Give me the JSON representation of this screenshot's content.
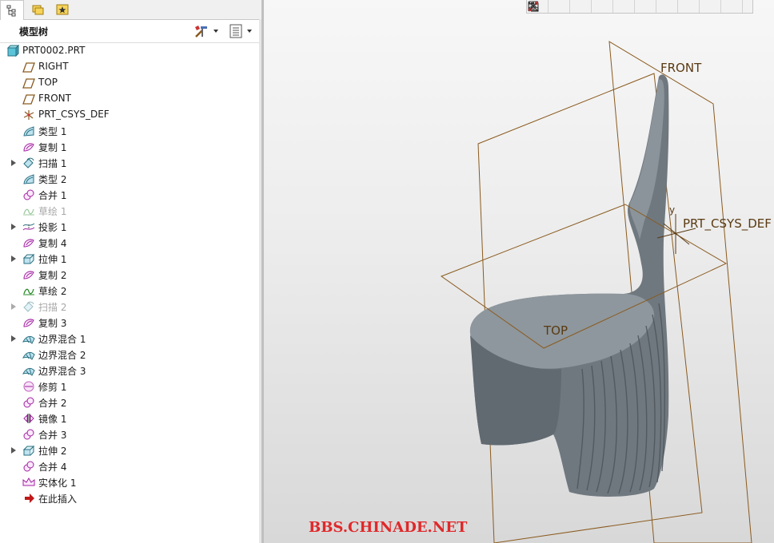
{
  "panel": {
    "tabs": [
      {
        "name": "model-tree-tab-icon",
        "active": true
      },
      {
        "name": "folder-browser-tab-icon",
        "active": false
      },
      {
        "name": "favorites-tab-icon",
        "active": false
      }
    ],
    "title": "模型树",
    "settings_icon": "tree-settings-icon",
    "columns_icon": "tree-columns-icon"
  },
  "tree": {
    "items": [
      {
        "label": "PRT0002.PRT",
        "icon": "part-icon",
        "expandable": false,
        "disabled": false,
        "root": true
      },
      {
        "label": "RIGHT",
        "icon": "datum-plane-icon",
        "expandable": false,
        "disabled": false
      },
      {
        "label": "TOP",
        "icon": "datum-plane-icon",
        "expandable": false,
        "disabled": false
      },
      {
        "label": "FRONT",
        "icon": "datum-plane-icon",
        "expandable": false,
        "disabled": false
      },
      {
        "label": "PRT_CSYS_DEF",
        "icon": "csys-icon",
        "expandable": false,
        "disabled": false
      },
      {
        "label": "类型 1",
        "icon": "style-icon",
        "expandable": false,
        "disabled": false
      },
      {
        "label": "复制 1",
        "icon": "copy-icon",
        "expandable": false,
        "disabled": false
      },
      {
        "label": "扫描 1",
        "icon": "sweep-icon",
        "expandable": true,
        "disabled": false
      },
      {
        "label": "类型 2",
        "icon": "style-icon",
        "expandable": false,
        "disabled": false
      },
      {
        "label": "合并 1",
        "icon": "merge-icon",
        "expandable": false,
        "disabled": false
      },
      {
        "label": "草绘 1",
        "icon": "sketch-icon",
        "expandable": false,
        "disabled": true
      },
      {
        "label": "投影 1",
        "icon": "project-icon",
        "expandable": true,
        "disabled": false
      },
      {
        "label": "复制 4",
        "icon": "copy-icon",
        "expandable": false,
        "disabled": false
      },
      {
        "label": "拉伸 1",
        "icon": "extrude-icon",
        "expandable": true,
        "disabled": false
      },
      {
        "label": "复制 2",
        "icon": "copy-icon",
        "expandable": false,
        "disabled": false
      },
      {
        "label": "草绘 2",
        "icon": "sketch-icon",
        "expandable": false,
        "disabled": false
      },
      {
        "label": "扫描 2",
        "icon": "sweep-icon",
        "expandable": true,
        "disabled": true
      },
      {
        "label": "复制 3",
        "icon": "copy-icon",
        "expandable": false,
        "disabled": false
      },
      {
        "label": "边界混合 1",
        "icon": "boundary-blend-icon",
        "expandable": true,
        "disabled": false
      },
      {
        "label": "边界混合 2",
        "icon": "boundary-blend-icon",
        "expandable": false,
        "disabled": false
      },
      {
        "label": "边界混合 3",
        "icon": "boundary-blend-icon",
        "expandable": false,
        "disabled": false
      },
      {
        "label": "修剪 1",
        "icon": "trim-icon",
        "expandable": false,
        "disabled": false
      },
      {
        "label": "合并 2",
        "icon": "merge-icon",
        "expandable": false,
        "disabled": false
      },
      {
        "label": "镜像 1",
        "icon": "mirror-icon",
        "expandable": false,
        "disabled": false
      },
      {
        "label": "合并 3",
        "icon": "merge-icon",
        "expandable": false,
        "disabled": false
      },
      {
        "label": "拉伸 2",
        "icon": "extrude-icon",
        "expandable": true,
        "disabled": false
      },
      {
        "label": "合并 4",
        "icon": "merge-icon",
        "expandable": false,
        "disabled": false
      },
      {
        "label": "实体化 1",
        "icon": "solidify-icon",
        "expandable": false,
        "disabled": false
      },
      {
        "label": "在此插入",
        "icon": "insert-here-arrow-icon",
        "expandable": false,
        "disabled": false
      }
    ]
  },
  "view_toolbar": {
    "buttons": [
      "refit-icon",
      "zoom-in-icon",
      "zoom-out-icon",
      "repaint-icon",
      "saved-views-icon",
      "display-style-icon",
      "camera-icon",
      "datum-display-icon",
      "spin-center-icon",
      "annotation-display-icon"
    ]
  },
  "viewport": {
    "datum_labels": {
      "front": "FRONT",
      "csys": "PRT_CSYS_DEF",
      "top": "TOP",
      "axis_y": "y"
    },
    "watermark": "BBS.CHINADE.NET",
    "colors": {
      "datum_line": "#8a5a1e",
      "model": "#6f787f",
      "watermark": "#e0282a"
    }
  }
}
